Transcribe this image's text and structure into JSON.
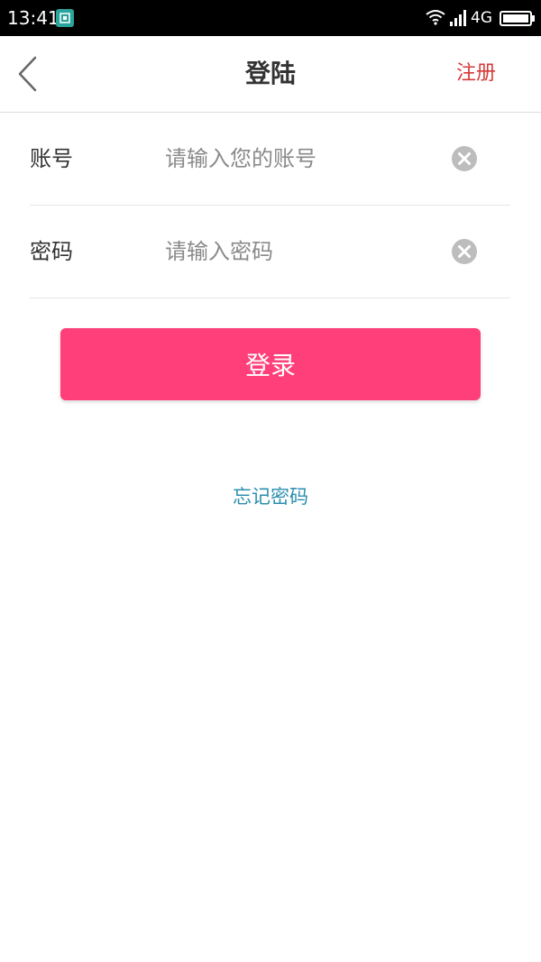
{
  "status_bar": {
    "time": "13:41",
    "network": "4G",
    "icons": [
      "screenshot-icon",
      "wifi-icon",
      "signal-icon",
      "battery-icon"
    ]
  },
  "nav": {
    "title": "登陆",
    "register_label": "注册",
    "back_icon": "chevron-left-icon"
  },
  "form": {
    "account": {
      "label": "账号",
      "placeholder": "请输入您的账号",
      "value": ""
    },
    "password": {
      "label": "密码",
      "placeholder": "请输入密码",
      "value": ""
    }
  },
  "actions": {
    "login_label": "登录",
    "forgot_label": "忘记密码"
  },
  "colors": {
    "primary": "#ff3f7a",
    "register": "#d63a3a",
    "link": "#2b8fb0"
  }
}
